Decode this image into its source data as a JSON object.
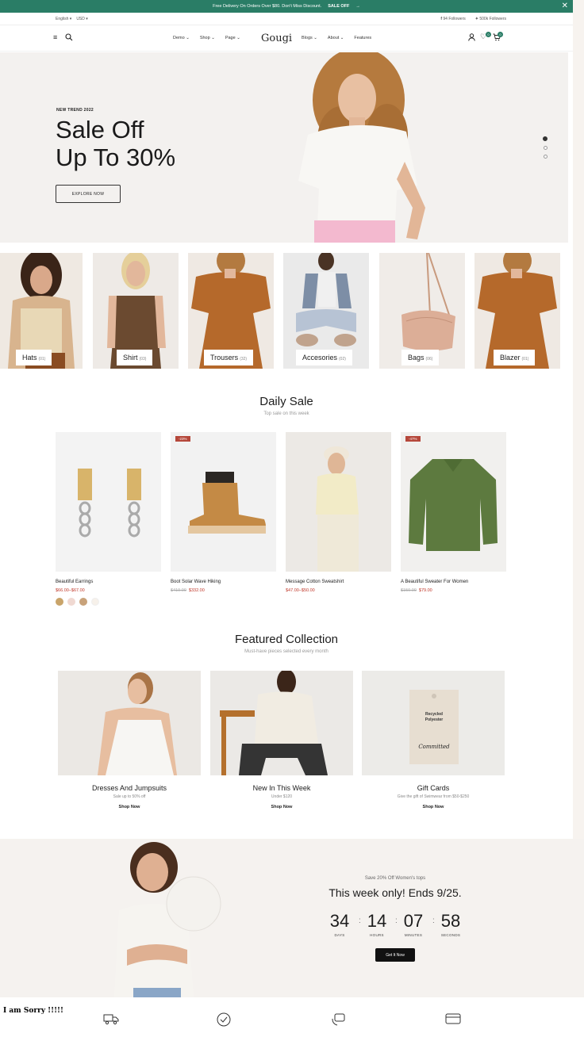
{
  "topbar": {
    "promo_text": "Free Delivery On Orders Over $80. Don't Miss Discount.",
    "promo_link": "SALE OFF",
    "arrow": "→",
    "close": "✕"
  },
  "utility": {
    "language": "English",
    "currency": "USD",
    "facebook": "94 Followers",
    "twitter": "500k Followers"
  },
  "nav": {
    "logo": "Gougi",
    "left_menu": [
      {
        "label": "Demo"
      },
      {
        "label": "Shop"
      },
      {
        "label": "Page"
      }
    ],
    "right_menu": [
      {
        "label": "Blogs"
      },
      {
        "label": "About"
      },
      {
        "label": "Features"
      }
    ],
    "wishlist_count": "0",
    "cart_count": "0"
  },
  "hero": {
    "eyebrow": "NEW TREND 2022",
    "title_line1": "Sale Off",
    "title_line2": "Up To 30%",
    "button": "EXPLORE NOW",
    "slides": 3,
    "active_slide": 1
  },
  "categories": [
    {
      "name": "Hats",
      "count": "(01)"
    },
    {
      "name": "Shirt",
      "count": "(03)"
    },
    {
      "name": "Trousers",
      "count": "(32)"
    },
    {
      "name": "Accesories",
      "count": "(02)"
    },
    {
      "name": "Bags",
      "count": "(06)"
    },
    {
      "name": "Blazer",
      "count": "(01)"
    }
  ],
  "daily_sale": {
    "title": "Daily Sale",
    "subtitle": "Top sale on this week",
    "products": [
      {
        "name": "Beautiful Earrings",
        "price": "$66.00–$67.00",
        "old_price": "",
        "tag": ""
      },
      {
        "name": "Boot Solar Wave Hiking",
        "price": "$332.00",
        "old_price": "$419.00",
        "tag": "-23%"
      },
      {
        "name": "Message Cotton Sweatshirt",
        "price": "$47.00–$50.00",
        "old_price": "",
        "tag": ""
      },
      {
        "name": "A Beautiful Sweater For Women",
        "price": "$79.00",
        "old_price": "$150.00",
        "tag": "-47%"
      }
    ],
    "swatches": [
      "#c9a46a",
      "#f0d9d2",
      "#c8a27a",
      "#f7f1ea"
    ]
  },
  "featured": {
    "title": "Featured Collection",
    "subtitle": "Must-have pieces selected every month",
    "items": [
      {
        "title": "Dresses And Jumpsuits",
        "sub": "Sale up to 50% off",
        "cta": "Shop Now"
      },
      {
        "title": "New In This Week",
        "sub": "Under $120",
        "cta": "Shop Now"
      },
      {
        "title": "Gift Cards",
        "sub": "Give the gift of Swimwear from $50-$250",
        "cta": "Shop Now"
      }
    ],
    "card_text": {
      "brand1": "Recycled",
      "brand2": "Polyester",
      "script": "Committed"
    }
  },
  "promo": {
    "small": "Save 20% Off Women's tops",
    "headline": "This week only! Ends 9/25.",
    "countdown": [
      {
        "value": "34",
        "unit": "DAYS"
      },
      {
        "value": "14",
        "unit": "HOURS"
      },
      {
        "value": "07",
        "unit": "MINUTES"
      },
      {
        "value": "58",
        "unit": "SECONDS"
      }
    ],
    "button": "Get It Now"
  },
  "footer_strip": {
    "sorry": "I am Sorry !!!!!"
  },
  "colors": {
    "brand": "#2a7d66",
    "sale": "#c0392b",
    "hero_bg": "#f3f1ef"
  }
}
